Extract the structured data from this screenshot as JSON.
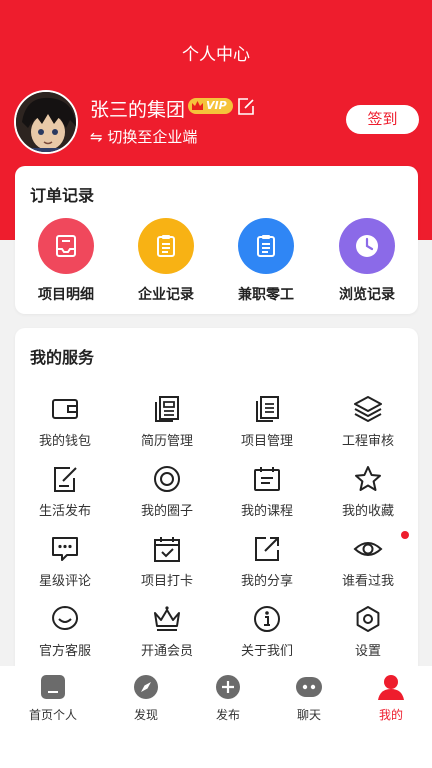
{
  "page": {
    "title": "个人中心"
  },
  "profile": {
    "name": "张三的集团",
    "vip_label": "VIP",
    "switch_label": "⇋ 切换至企业端",
    "checkin_label": "签到"
  },
  "orders": {
    "title": "订单记录",
    "items": [
      {
        "label": "项目明细",
        "icon": "inbox-icon",
        "color": "#f0485c"
      },
      {
        "label": "企业记录",
        "icon": "clipboard-icon",
        "color": "#f8b214"
      },
      {
        "label": "兼职零工",
        "icon": "clipboard-icon",
        "color": "#2f86f5"
      },
      {
        "label": "浏览记录",
        "icon": "clock-icon",
        "color": "#8b6ae8"
      }
    ]
  },
  "services": {
    "title": "我的服务",
    "items": [
      {
        "label": "我的钱包",
        "icon": "wallet-icon"
      },
      {
        "label": "简历管理",
        "icon": "resume-icon"
      },
      {
        "label": "项目管理",
        "icon": "documents-icon"
      },
      {
        "label": "工程审核",
        "icon": "layers-icon"
      },
      {
        "label": "生活发布",
        "icon": "edit-note-icon"
      },
      {
        "label": "我的圈子",
        "icon": "circle-icon"
      },
      {
        "label": "我的课程",
        "icon": "calendar-board-icon"
      },
      {
        "label": "我的收藏",
        "icon": "star-icon"
      },
      {
        "label": "星级评论",
        "icon": "comment-icon"
      },
      {
        "label": "项目打卡",
        "icon": "calendar-check-icon"
      },
      {
        "label": "我的分享",
        "icon": "share-icon"
      },
      {
        "label": "谁看过我",
        "icon": "eye-icon"
      },
      {
        "label": "官方客服",
        "icon": "smile-icon"
      },
      {
        "label": "开通会员",
        "icon": "crown-icon"
      },
      {
        "label": "关于我们",
        "icon": "info-icon"
      },
      {
        "label": "设置",
        "icon": "settings-icon"
      }
    ]
  },
  "nav": {
    "items": [
      {
        "label": "首页个人",
        "icon": "home-icon"
      },
      {
        "label": "发现",
        "icon": "compass-icon"
      },
      {
        "label": "发布",
        "icon": "plus-icon"
      },
      {
        "label": "聊天",
        "icon": "chat-icon"
      },
      {
        "label": "我的",
        "icon": "user-icon",
        "active": true
      }
    ]
  },
  "colors": {
    "accent": "#ee1d2d",
    "vip": "#f5c33b"
  }
}
